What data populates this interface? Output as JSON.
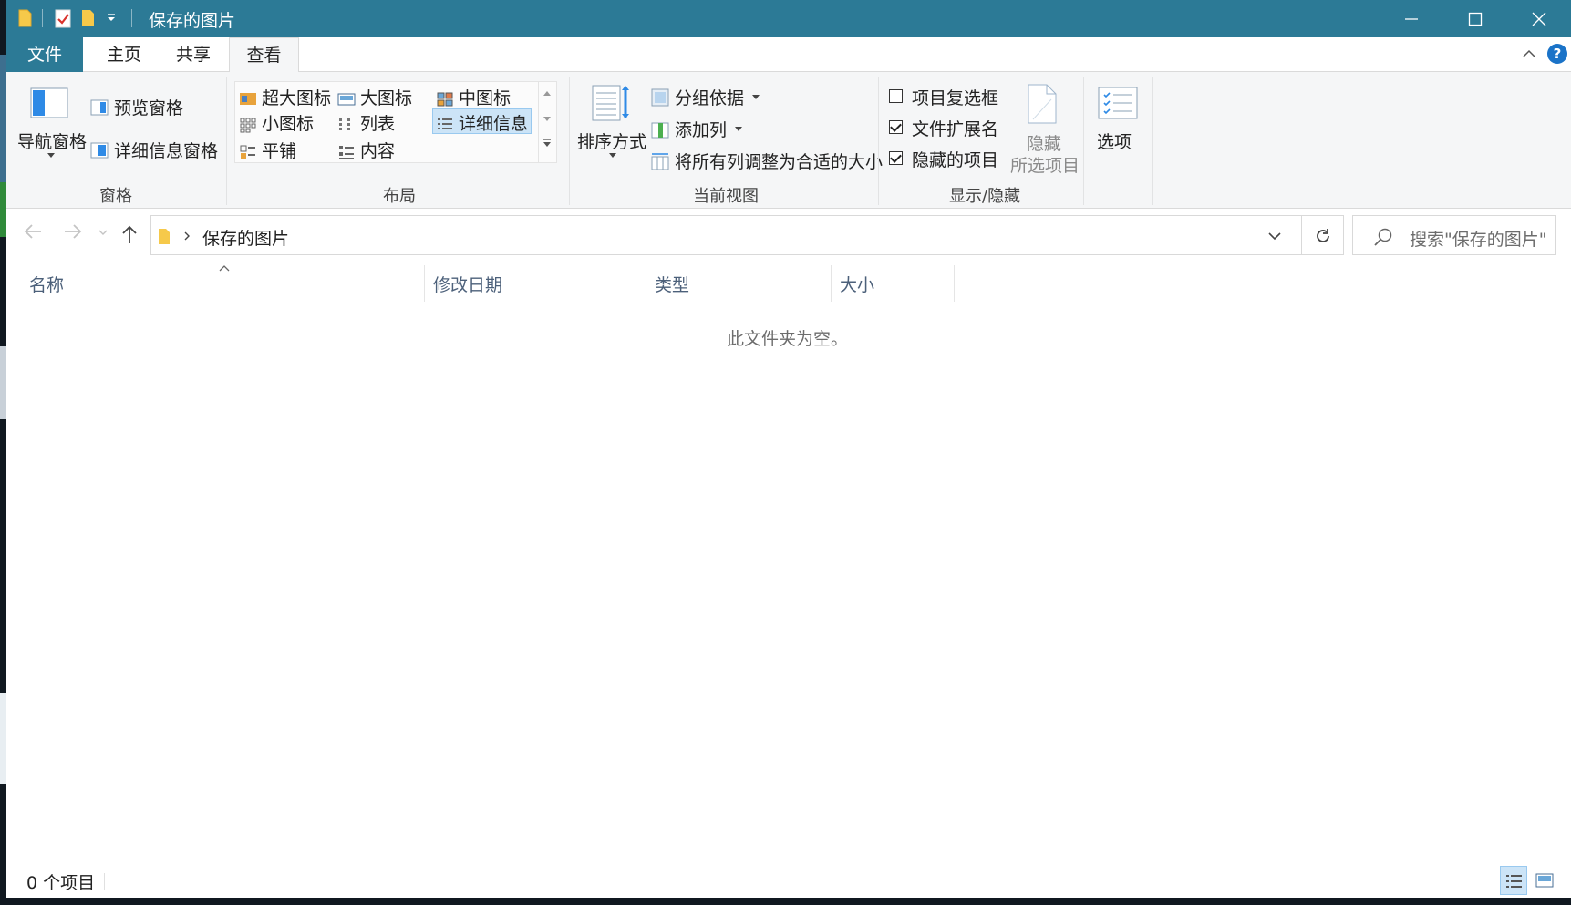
{
  "window": {
    "title": "保存的图片",
    "colors": {
      "accent": "#2c7a96",
      "ribbon_bg": "#f5f6f7",
      "selected": "#cce4f7"
    }
  },
  "tabs": [
    {
      "label": "文件"
    },
    {
      "label": "主页"
    },
    {
      "label": "共享"
    },
    {
      "label": "查看",
      "active": true
    }
  ],
  "ribbon": {
    "panes": {
      "nav_pane": "导航窗格",
      "preview_pane": "预览窗格",
      "details_pane": "详细信息窗格",
      "group_label": "窗格"
    },
    "layout": {
      "items": [
        "超大图标",
        "大图标",
        "中图标",
        "小图标",
        "列表",
        "详细信息",
        "平铺",
        "内容"
      ],
      "selected": "详细信息",
      "group_label": "布局"
    },
    "current_view": {
      "sort_by": "排序方式",
      "group_by": "分组依据",
      "add_column": "添加列",
      "fit_columns": "将所有列调整为合适的大小",
      "group_label": "当前视图"
    },
    "show_hide": {
      "item_checkboxes": {
        "label": "项目复选框",
        "checked": false
      },
      "file_extensions": {
        "label": "文件扩展名",
        "checked": true
      },
      "hidden_items": {
        "label": "隐藏的项目",
        "checked": true
      },
      "hide_selected_line1": "隐藏",
      "hide_selected_line2": "所选项目",
      "group_label": "显示/隐藏"
    },
    "options": "选项"
  },
  "address": {
    "path": "保存的图片",
    "search_placeholder": "搜索\"保存的图片\""
  },
  "columns": [
    "名称",
    "修改日期",
    "类型",
    "大小"
  ],
  "empty_message": "此文件夹为空。",
  "status": {
    "item_count": "0 个项目"
  }
}
